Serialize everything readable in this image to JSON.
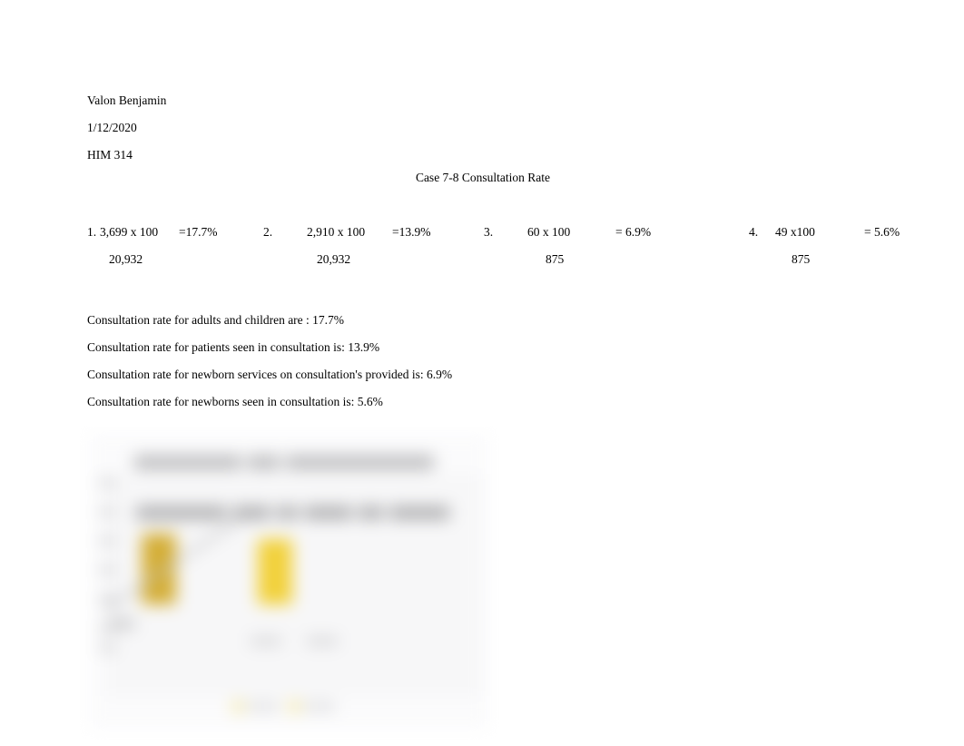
{
  "document": {
    "author": "Valon Benjamin",
    "date": "1/12/2020",
    "course": "HIM 314",
    "title": "Case 7-8 Consultation Rate"
  },
  "calculations": [
    {
      "index": "1.",
      "numerator": "3,699 x 100",
      "denominator": "20,932",
      "result": "=17.7%"
    },
    {
      "index": "2.",
      "numerator": "2,910 x 100",
      "denominator": "20,932",
      "result": "=13.9%"
    },
    {
      "index": "3.",
      "numerator": "60 x 100",
      "denominator": "875",
      "result": "= 6.9%"
    },
    {
      "index": "4.",
      "numerator": "49 x100",
      "denominator": "875",
      "result": "= 5.6%"
    }
  ],
  "answers": [
    "Consultation rate for adults and children are : 17.7%",
    "Consultation rate for patients seen in consultation is: 13.9%",
    "Consultation rate for newborn services on consultation's provided is: 6.9%",
    "Consultation rate for newborns seen in consultation is: 5.6%"
  ],
  "chart_data": {
    "type": "bar",
    "title": "Consultation Rate for Newborns",
    "subtitle": "Consultation Rate for Adults and Children",
    "legend_position": "bottom",
    "grid": false,
    "blurred": true,
    "categories": [
      "Series 1",
      "Series 2"
    ],
    "values": [
      17.7,
      13.9
    ],
    "xlabel": "",
    "ylabel": "",
    "series": [
      {
        "name": "Series 1",
        "values": [
          17.7
        ],
        "color": "#d4ae36"
      },
      {
        "name": "Series 2",
        "values": [
          13.9
        ],
        "color": "#f2d13b"
      }
    ],
    "colors": {
      "bar_1": "#d4ae36",
      "bar_2": "#f2d13b",
      "legend_swatch_1": "#f3e8a8",
      "legend_swatch_2": "#f5e9a4",
      "panel_background": "#f7f7f8",
      "chart_background": "#fbfbfc"
    }
  }
}
